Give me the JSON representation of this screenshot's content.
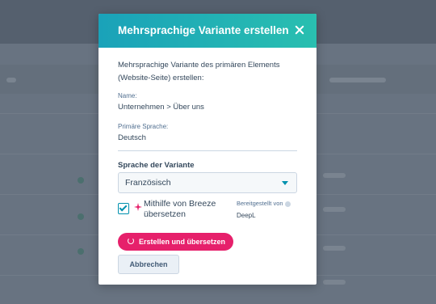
{
  "dialog": {
    "title": "Mehrsprachige Variante erstellen",
    "description": "Mehrsprachige Variante des primären Elements (Website-Seite) erstellen:",
    "name_label": "Name:",
    "name_value": "Unternehmen > Über uns",
    "primary_language_label": "Primäre Sprache:",
    "primary_language_value": "Deutsch",
    "variant_language_label": "Sprache der Variante",
    "variant_language_selected": "Französisch",
    "breeze_checkbox_label": "Mithilfe von Breeze übersetzen",
    "breeze_checked": true,
    "provided_by_label": "Bereitgestellt von",
    "provider": "DeepL",
    "primary_button": "Erstellen und übersetzen",
    "cancel_button": "Abbrechen"
  },
  "colors": {
    "header_gradient_start": "#1aa2b9",
    "header_gradient_end": "#29bfb0",
    "primary_button": "#e6206b",
    "accent": "#0091ae"
  },
  "icons": [
    "close-icon",
    "dropdown-caret-icon",
    "checkbox-check-icon",
    "sparkle-icon",
    "info-icon",
    "refresh-icon"
  ]
}
